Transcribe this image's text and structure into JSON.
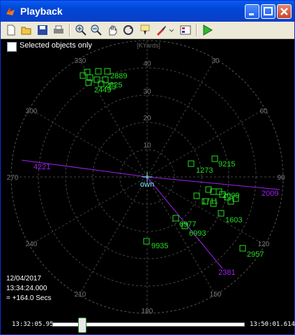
{
  "window": {
    "title": "Playback"
  },
  "toolbar": {
    "icons": [
      "new-icon",
      "open-icon",
      "save-icon",
      "print-icon",
      "zoom-in-icon",
      "zoom-out-icon",
      "pan-icon",
      "rotate-icon",
      "data-cursor-icon",
      "brush-icon",
      "legend-icon",
      "play-icon"
    ]
  },
  "filter": {
    "label": "Selected objects only",
    "checked": false
  },
  "polar": {
    "units": "[KYards]",
    "rings": [
      {
        "label": "10"
      },
      {
        "label": "20"
      },
      {
        "label": "30"
      },
      {
        "label": "40"
      }
    ],
    "angle_labels": [
      {
        "label": "330"
      },
      {
        "label": "30"
      },
      {
        "label": "300"
      },
      {
        "label": "60"
      },
      {
        "label": "270"
      },
      {
        "label": "90"
      },
      {
        "label": "240"
      },
      {
        "label": "120"
      },
      {
        "label": "210"
      },
      {
        "label": "150"
      },
      {
        "label": "180"
      }
    ],
    "center_label": "own",
    "purple_tracks": [
      {
        "label": "4221"
      },
      {
        "label": "2009"
      },
      {
        "label": "2381"
      }
    ],
    "contacts": [
      {
        "label": "1273"
      },
      {
        "label": "9215"
      },
      {
        "label": "1711"
      },
      {
        "label": "2009"
      },
      {
        "label": "1603"
      },
      {
        "label": "6977"
      },
      {
        "label": "6993"
      },
      {
        "label": "9935"
      },
      {
        "label": "2957"
      },
      {
        "label": "2889"
      },
      {
        "label": "2825"
      },
      {
        "label": "2449"
      }
    ]
  },
  "status": {
    "date": "12/04/2017",
    "time": "13:34:24.000",
    "offset": "= +164.0 Secs"
  },
  "timeline": {
    "start": "13:32:05.95",
    "end": "13:50:01.614",
    "position": 0.1
  }
}
